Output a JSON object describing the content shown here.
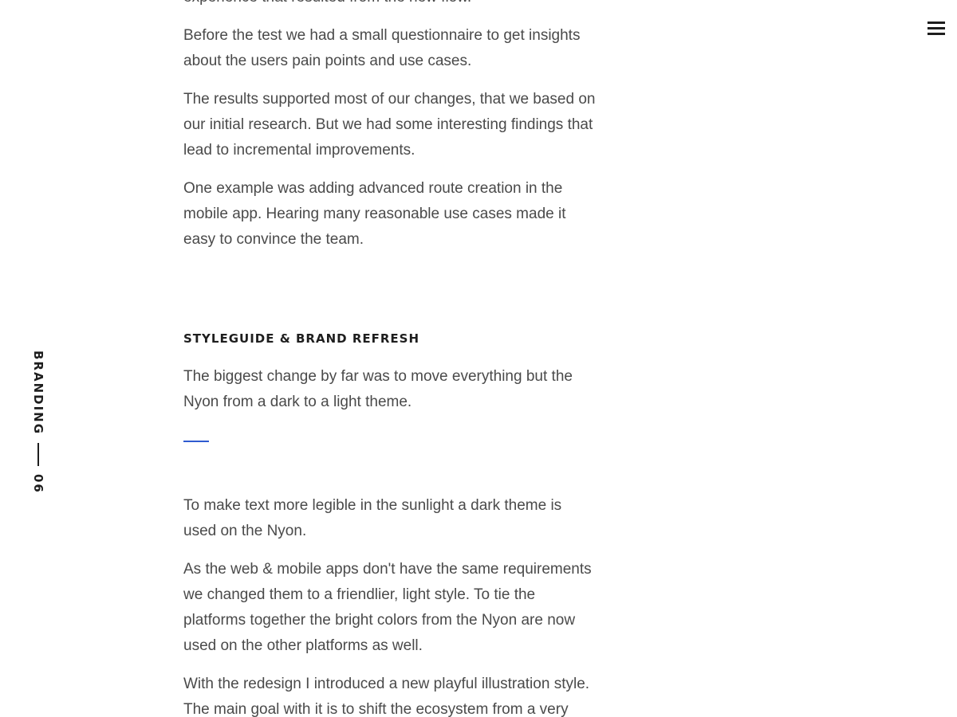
{
  "nav": {
    "menu_icon": "hamburger-icon"
  },
  "section_marker": {
    "label": "BRANDING",
    "number": "06"
  },
  "intro": {
    "paragraphs": [
      "experience that resulted from the new flow.",
      "Before the test we had a small questionnaire to get insights about the users pain points and use cases.",
      "The results supported most of our changes, that we based on our initial research. But we had some interesting findings that lead to incremental improvements.",
      "One example was adding advanced route creation in the mobile app. Hearing many reasonable use cases made it easy to convince the team."
    ]
  },
  "styleguide": {
    "heading": "STYLEGUIDE & BRAND REFRESH",
    "lead": "The biggest change by far was to move everything but the Nyon from a dark to a light theme.",
    "paragraphs": [
      "To make text more legible in the sunlight a dark theme is used on the Nyon.",
      "As the web & mobile apps don't have the same requirements we changed them to a friendlier, light style. To tie the platforms together the bright colors from the Nyon are now used on the other platforms as well.",
      "With the redesign I introduced a new playful illustration style. The main goal with it is to shift the ecosystem from a very"
    ]
  },
  "colors": {
    "text": "#4a4a4a",
    "heading": "#1e1e1e",
    "accent": "#2f5bd0",
    "background": "#ffffff"
  }
}
